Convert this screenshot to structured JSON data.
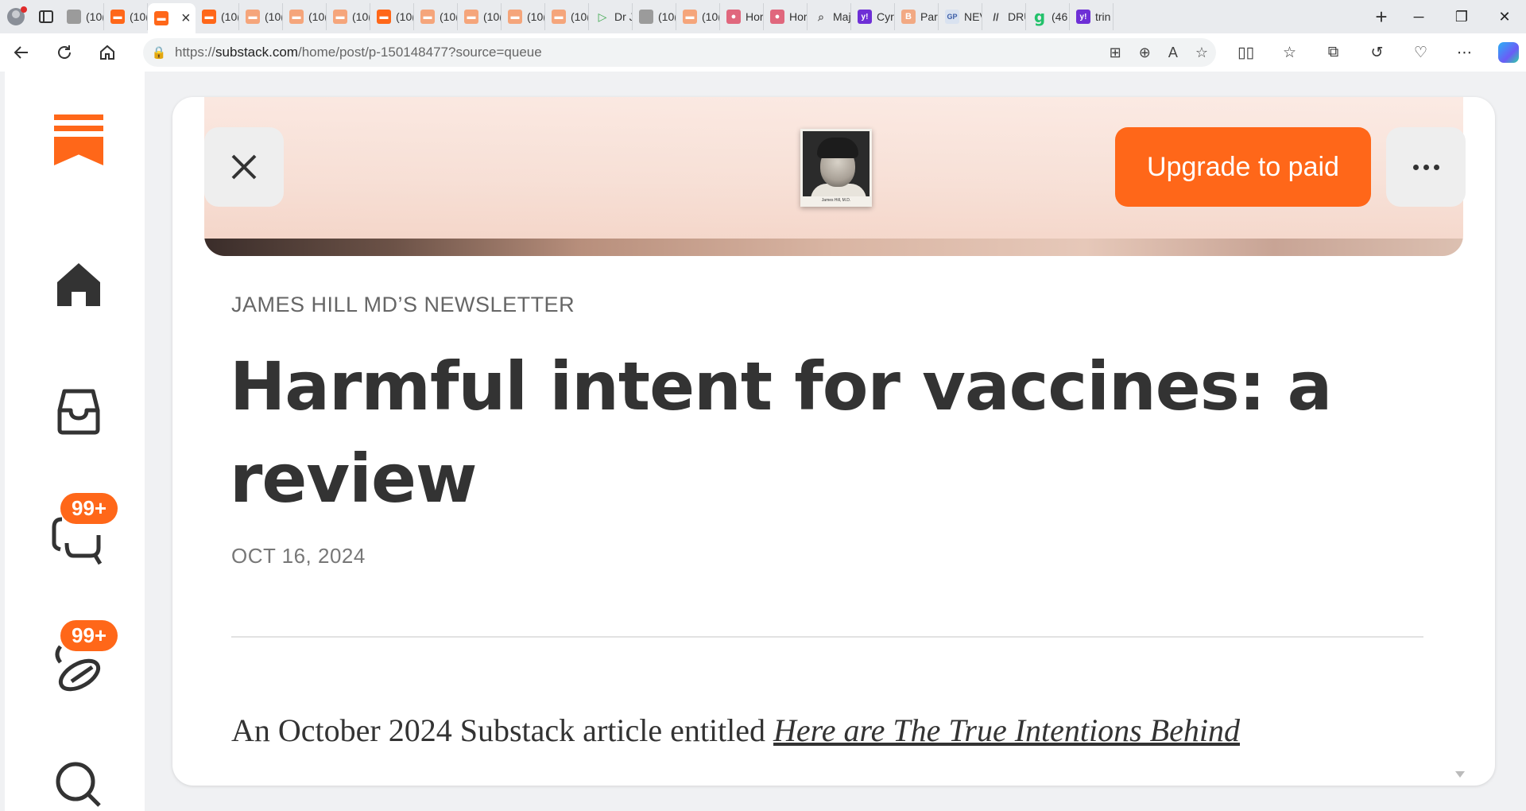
{
  "browser": {
    "tabs": [
      {
        "favicon": "image-favicon",
        "label": "(10(",
        "active": false
      },
      {
        "favicon": "substack-favicon",
        "label": "(10(",
        "active": false
      },
      {
        "favicon": "substack-favicon",
        "label": "",
        "active": true
      },
      {
        "favicon": "substack-favicon",
        "label": "(10(",
        "active": false
      },
      {
        "favicon": "substack-favicon-faded",
        "label": "(10(",
        "active": false
      },
      {
        "favicon": "substack-favicon-faded",
        "label": "(10(",
        "active": false
      },
      {
        "favicon": "substack-favicon-faded",
        "label": "(10(",
        "active": false
      },
      {
        "favicon": "substack-favicon",
        "label": "(10(",
        "active": false
      },
      {
        "favicon": "substack-favicon-faded",
        "label": "(10(",
        "active": false
      },
      {
        "favicon": "substack-favicon-faded",
        "label": "(10(",
        "active": false
      },
      {
        "favicon": "substack-favicon-faded",
        "label": "(10(",
        "active": false
      },
      {
        "favicon": "substack-favicon-faded",
        "label": "(10(",
        "active": false
      },
      {
        "favicon": "rumble-favicon",
        "label": "Dr J",
        "active": false
      },
      {
        "favicon": "image-favicon",
        "label": "(10(",
        "active": false
      },
      {
        "favicon": "substack-favicon-faded",
        "label": "(10(",
        "active": false
      },
      {
        "favicon": "podcast-favicon",
        "label": "Hor",
        "active": false
      },
      {
        "favicon": "podcast-favicon",
        "label": "Hor",
        "active": false
      },
      {
        "favicon": "search-favicon",
        "label": "Maj",
        "active": false
      },
      {
        "favicon": "yahoo-favicon",
        "label": "Cyr",
        "active": false
      },
      {
        "favicon": "b-favicon",
        "label": "Par",
        "active": false
      },
      {
        "favicon": "gp-favicon",
        "label": "NEV",
        "active": false
      },
      {
        "favicon": "drudge-favicon",
        "label": "DRU",
        "active": false
      },
      {
        "favicon": "g-favicon",
        "label": "(46",
        "active": false
      },
      {
        "favicon": "yahoo-favicon",
        "label": "trin",
        "active": false
      }
    ],
    "address": {
      "prefix": "https://",
      "domain": "substack.com",
      "path": "/home/post/p-150148477?source=queue"
    }
  },
  "sidebar": {
    "inbox_badge": "99+",
    "activity_badge": "99+"
  },
  "post": {
    "publication": "JAMES HILL MD’S NEWSLETTER",
    "title": "Harmful intent for vaccines: a review",
    "date": "OCT 16, 2024",
    "body_lead": "An October 2024 Substack article entitled ",
    "body_link": "Here are The True Intentions Behind",
    "upgrade_label": "Upgrade to paid",
    "avatar_caption": "James Hill, M.D."
  },
  "colors": {
    "brand": "#ff6719",
    "text": "#333333",
    "muted": "#666666"
  }
}
